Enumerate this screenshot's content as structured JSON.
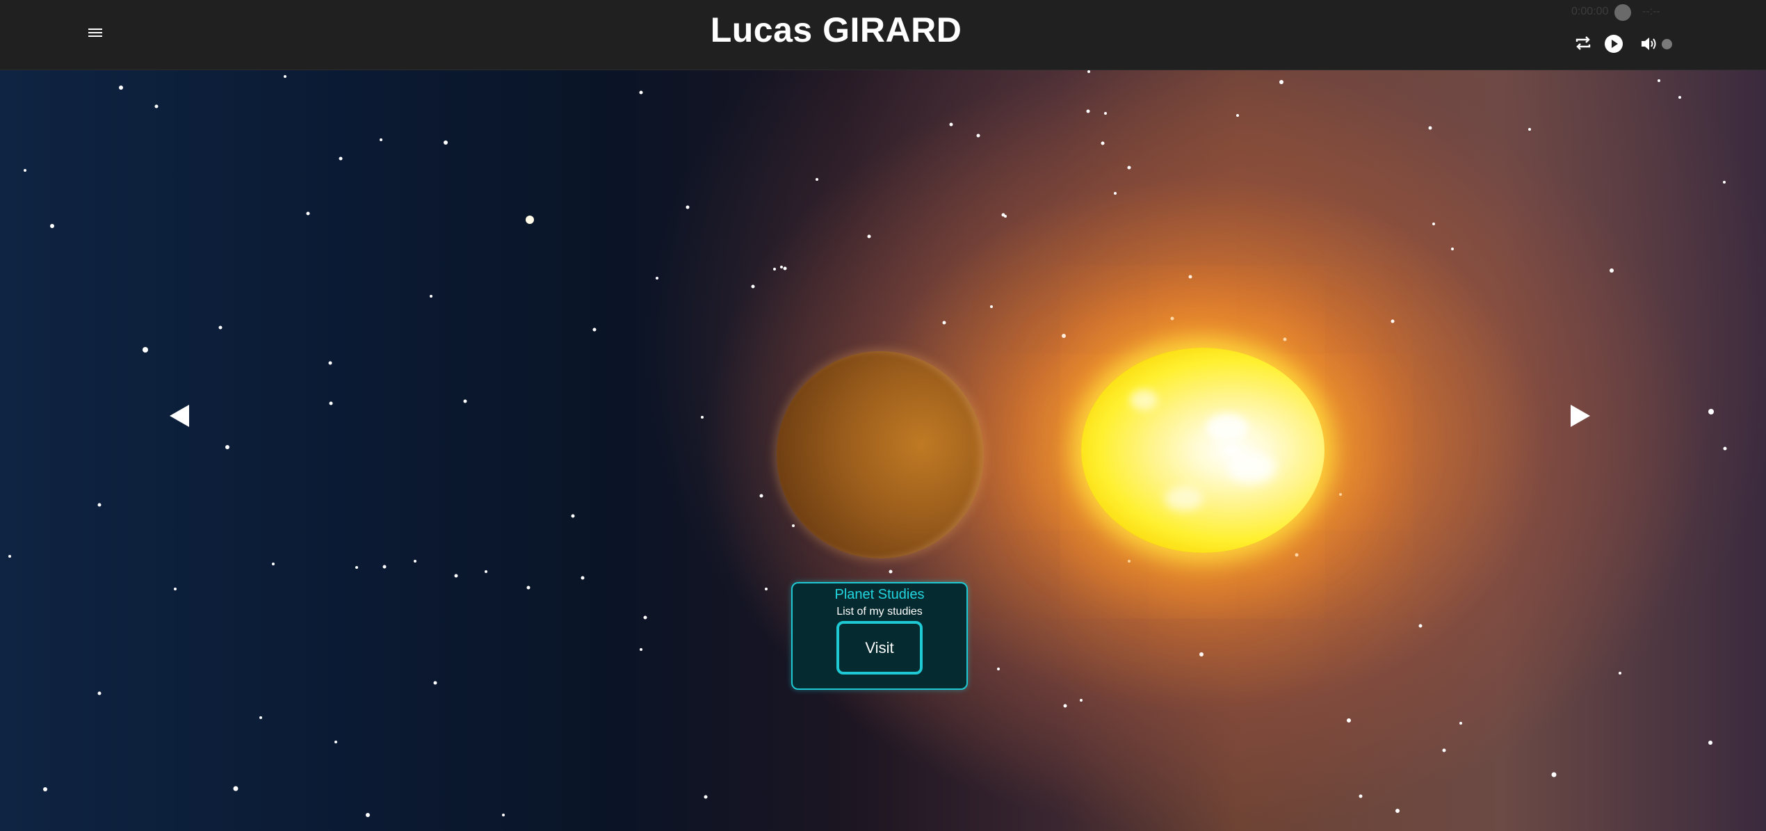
{
  "header": {
    "title": "Lucas GIRARD",
    "menu_icon": "hamburger-menu-icon",
    "player": {
      "current_time": "0:00:00",
      "duration": "--:--",
      "progress": 0,
      "volume_level": 0,
      "icons": [
        "repeat-icon",
        "play-icon",
        "volume-icon"
      ]
    }
  },
  "nav": {
    "prev_icon": "triangle-left-icon",
    "next_icon": "triangle-right-icon"
  },
  "card": {
    "title": "Planet Studies",
    "subtitle": "List of my studies",
    "button_label": "Visit"
  },
  "colors": {
    "header_bg": "#202020",
    "accent": "#1ec9d3",
    "card_bg": "#052a2f"
  }
}
